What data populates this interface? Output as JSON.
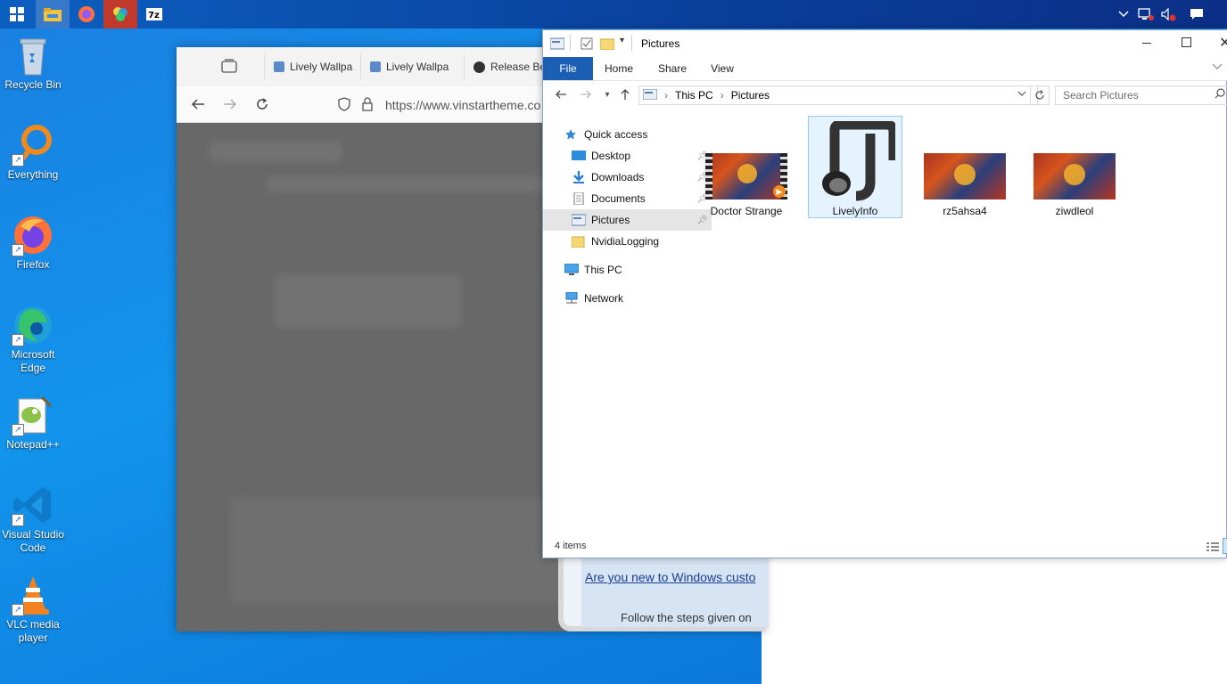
{
  "taskbar": {
    "apps": [
      {
        "name": "start-button"
      },
      {
        "name": "file-explorer"
      },
      {
        "name": "firefox"
      },
      {
        "name": "paint-app"
      },
      {
        "name": "7zip"
      }
    ]
  },
  "desktop_icons": [
    {
      "label": "Recycle Bin"
    },
    {
      "label": "Everything"
    },
    {
      "label": "Firefox"
    },
    {
      "label": "Microsoft Edge"
    },
    {
      "label": "Notepad++"
    },
    {
      "label": "Visual Studio Code"
    },
    {
      "label": "VLC media player"
    }
  ],
  "browser": {
    "tabs": [
      {
        "label": "Lively Wallpa"
      },
      {
        "label": "Lively Wallpa"
      },
      {
        "label": "Release Be"
      }
    ],
    "url": "https://www.vinstartheme.co",
    "popup_link": "Are you new to Windows custo",
    "popup_text": "Follow the steps given on"
  },
  "explorer": {
    "title": "Pictures",
    "ribbon_tabs": [
      "File",
      "Home",
      "Share",
      "View"
    ],
    "breadcrumb": [
      "This PC",
      "Pictures"
    ],
    "search_placeholder": "Search Pictures",
    "nav": {
      "quick_access": "Quick access",
      "items": [
        "Desktop",
        "Downloads",
        "Documents",
        "Pictures",
        "NvidiaLogging"
      ],
      "this_pc": "This PC",
      "network": "Network"
    },
    "files": [
      {
        "label": "Doctor Strange",
        "type": "video"
      },
      {
        "label": "LivelyInfo",
        "type": "folder"
      },
      {
        "label": "rz5ahsa4",
        "type": "image"
      },
      {
        "label": "ziwdleol",
        "type": "image"
      }
    ],
    "status": "4 items"
  }
}
